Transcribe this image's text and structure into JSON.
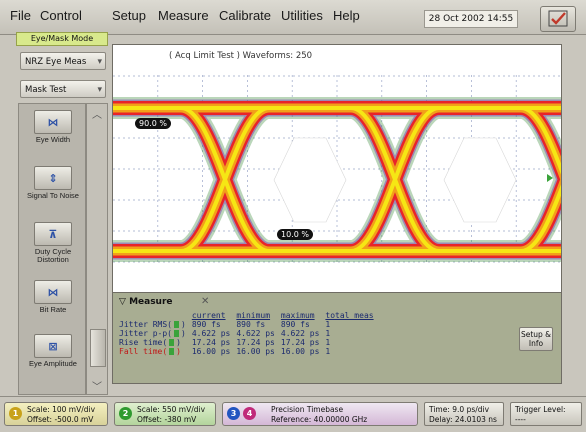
{
  "menu": {
    "items": [
      "File",
      "Control",
      "Setup",
      "Measure",
      "Calibrate",
      "Utilities",
      "Help"
    ],
    "datetime": "28 Oct 2002  14:55"
  },
  "sidebar": {
    "mode_label": "Eye/Mask Mode",
    "format_select": "NRZ Eye Meas",
    "test_select": "Mask Test",
    "tools": [
      {
        "icon": "eye-width-icon",
        "label": "Eye Width"
      },
      {
        "icon": "signal-to-noise-icon",
        "label": "Signal To Noise"
      },
      {
        "icon": "duty-cycle-icon",
        "label": "Duty Cycle Distortion"
      },
      {
        "icon": "bit-rate-icon",
        "label": "Bit Rate"
      },
      {
        "icon": "eye-amplitude-icon",
        "label": "Eye Amplitude"
      }
    ]
  },
  "plot": {
    "title": "( Acq Limit Test )  Waveforms: 250",
    "marker_upper": "90.0 %",
    "marker_lower": "10.0 %",
    "colors": {
      "outer": "#e8242a",
      "middle": "#f2a01a",
      "core": "#f6e714",
      "noise": "#3a8a3a"
    }
  },
  "measure": {
    "tab": "Measure",
    "headers": [
      "current",
      "minimum",
      "maximum",
      "total meas"
    ],
    "rows": [
      {
        "name": "Jitter RMS(",
        "current": "890 fs",
        "minimum": "890 fs",
        "maximum": "890 fs",
        "total": "1",
        "color": "#f6e714"
      },
      {
        "name": "Jitter p-p(",
        "current": "4.622 ps",
        "minimum": "4.622 ps",
        "maximum": "4.622 ps",
        "total": "1",
        "color": "#f6e714"
      },
      {
        "name": "Rise time(",
        "current": "17.24 ps",
        "minimum": "17.24 ps",
        "maximum": "17.24 ps",
        "total": "1",
        "color": "#f6e714"
      },
      {
        "name": "Fall time(",
        "current": "16.00 ps",
        "minimum": "16.00 ps",
        "maximum": "16.00 ps",
        "total": "1",
        "color": "#f6e714"
      }
    ],
    "setup_info": "Setup & Info"
  },
  "status": {
    "ch1": {
      "num": "1",
      "line1": "Scale: 100 mV/div",
      "line2": "Offset: -500.0 mV"
    },
    "ch2": {
      "num": "2",
      "line1": "Scale: 550 mV/div",
      "line2": "Offset: -380 mV"
    },
    "ch3": {
      "num": "3",
      "num2": "4",
      "line1": "Precision Timebase",
      "line2": "Reference: 40.00000 GHz"
    },
    "time": {
      "line1": "Time: 9.0 ps/div",
      "line2": "Delay: 24.0103 ns"
    },
    "trigger": {
      "line1": "Trigger Level:",
      "line2": "----"
    }
  }
}
